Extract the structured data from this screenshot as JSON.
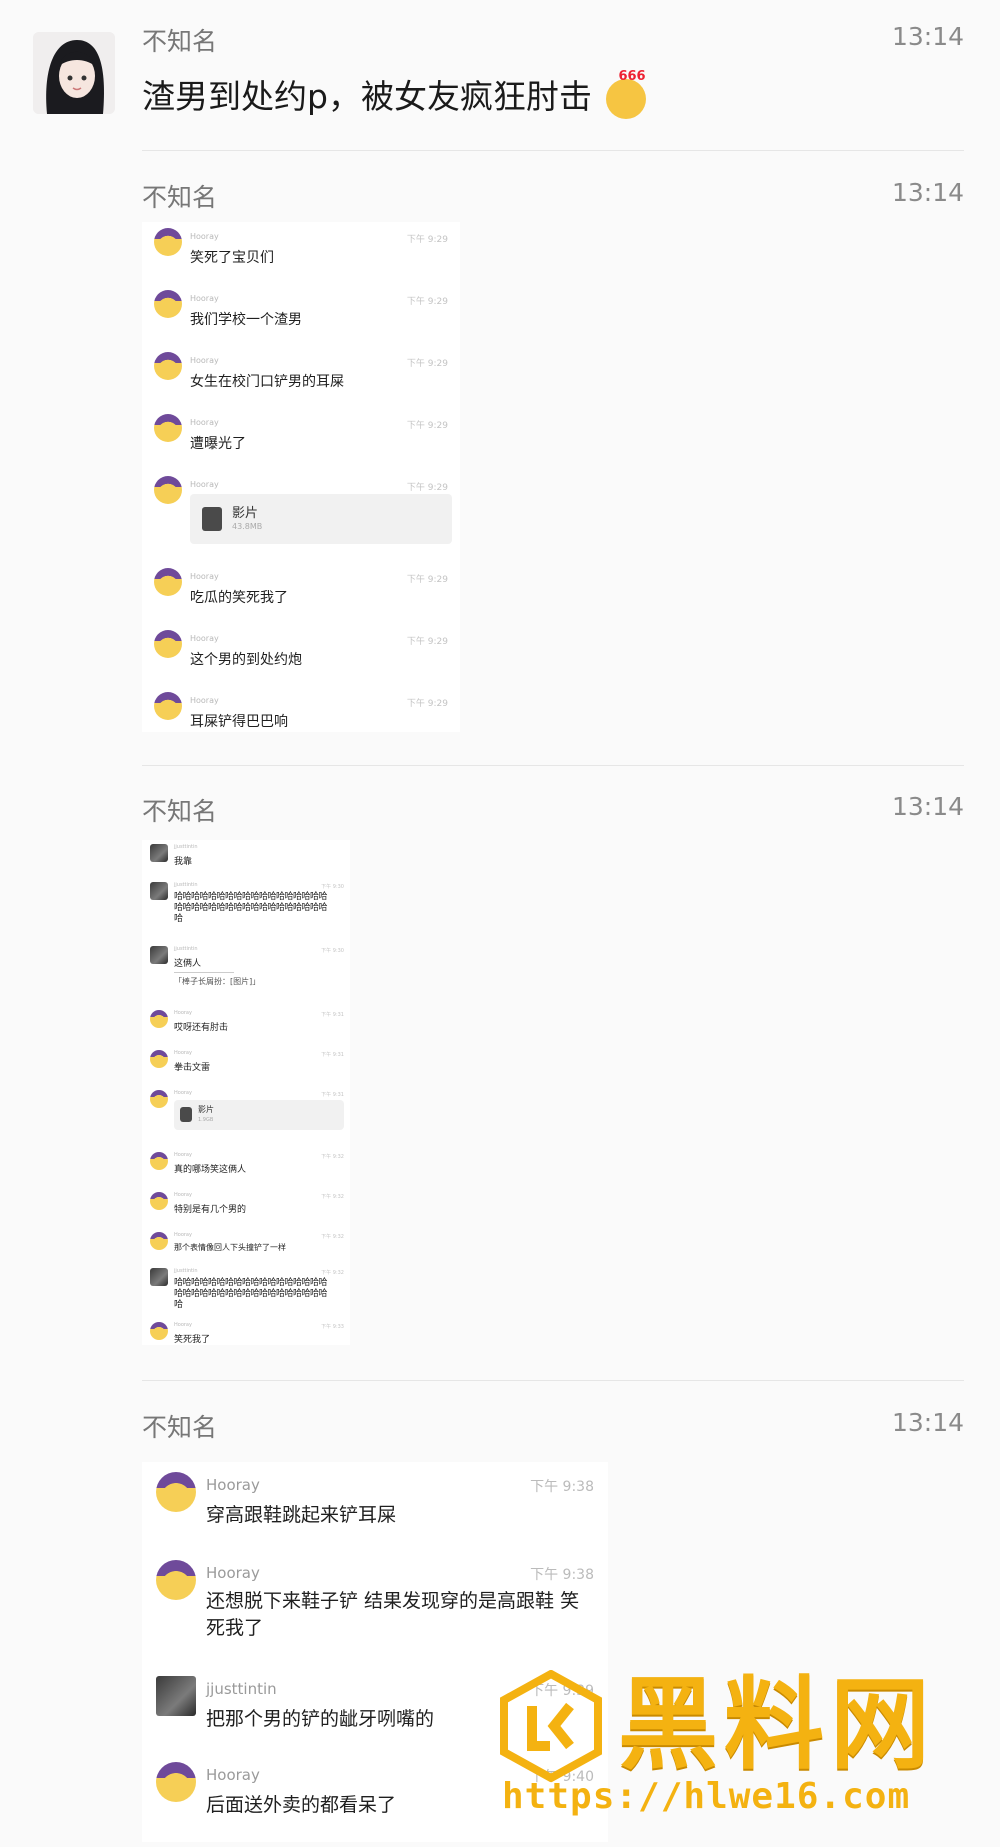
{
  "posts": [
    {
      "author": "不知名",
      "time": "13:14",
      "text": "渣男到处约p，被女友疯狂肘击",
      "emoji_badge": "666"
    },
    {
      "author": "不知名",
      "time": "13:14"
    },
    {
      "author": "不知名",
      "time": "13:14"
    },
    {
      "author": "不知名",
      "time": "13:14"
    }
  ],
  "shot1": {
    "messages": [
      {
        "text": "笑死了宝贝们"
      },
      {
        "text": "我们学校一个渣男"
      },
      {
        "text": "女生在校门口铲男的耳屎"
      },
      {
        "text": "遭曝光了"
      },
      {
        "file": "影片"
      },
      {
        "text": "吃瓜的笑死我了"
      },
      {
        "text": "这个男的到处约炮"
      },
      {
        "text": "耳屎铲得巴巴响"
      }
    ]
  },
  "shot2": {
    "messages": [
      {
        "text": "我靠"
      },
      {
        "text": "哈哈哈哈哈哈哈哈哈哈哈哈哈哈哈哈哈哈哈哈哈哈哈哈哈哈哈哈哈哈哈哈哈哈哈哈哈"
      },
      {
        "text": "这俩人",
        "quote": "「棒子长屑扮：[图片]」"
      },
      {
        "text": "哎呀还有肘击"
      },
      {
        "text": "拳击文雷"
      },
      {
        "file": "影片"
      },
      {
        "text": "真的哪场笑这俩人"
      },
      {
        "text": "特别是有几个男的"
      },
      {
        "text": "那个表情像回人下头撞铲了一样"
      },
      {
        "text": "哈哈哈哈哈哈哈哈哈哈哈哈哈哈哈哈哈哈哈哈哈哈哈哈哈哈哈哈哈哈哈哈哈哈哈哈哈"
      },
      {
        "text": "笑死我了"
      }
    ]
  },
  "shot3": {
    "messages": [
      {
        "name": "Hooray",
        "time": "下午 9:38",
        "text": "穿高跟鞋跳起来铲耳屎"
      },
      {
        "name": "Hooray",
        "time": "下午 9:38",
        "text": "还想脱下来鞋子铲 结果发现穿的是高跟鞋 笑死我了"
      },
      {
        "name": "jjusttintin",
        "time": "下午 9:39",
        "text": "把那个男的铲的龇牙咧嘴的"
      },
      {
        "name": "Hooray",
        "time": "下午 9:40",
        "text": "后面送外卖的都看呆了"
      }
    ]
  },
  "watermark": {
    "title": "黑料网",
    "url": "https://hlwe16.com"
  }
}
